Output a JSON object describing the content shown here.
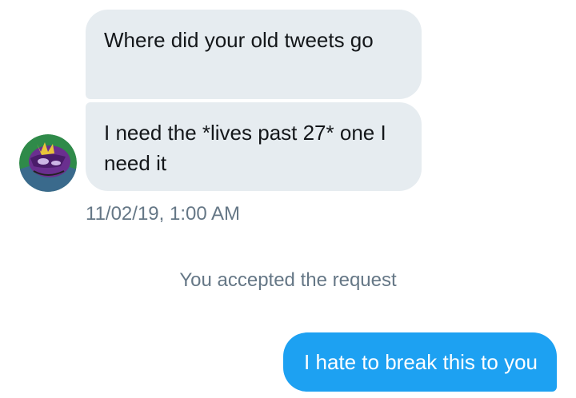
{
  "conversation": {
    "incoming": [
      {
        "text": "Where did your old tweets go"
      },
      {
        "text": "I need the *lives past 27* one I need it"
      }
    ],
    "timestamp": "11/02/19, 1:00 AM",
    "system_message": "You accepted the request",
    "outgoing": [
      {
        "text": "I hate to break this to you"
      }
    ]
  },
  "avatar": {
    "icon": "spyro-avatar-icon"
  },
  "colors": {
    "incoming_bubble": "#e6ecf0",
    "outgoing_bubble": "#1da1f2",
    "meta_text": "#657786",
    "message_text": "#14171a"
  }
}
